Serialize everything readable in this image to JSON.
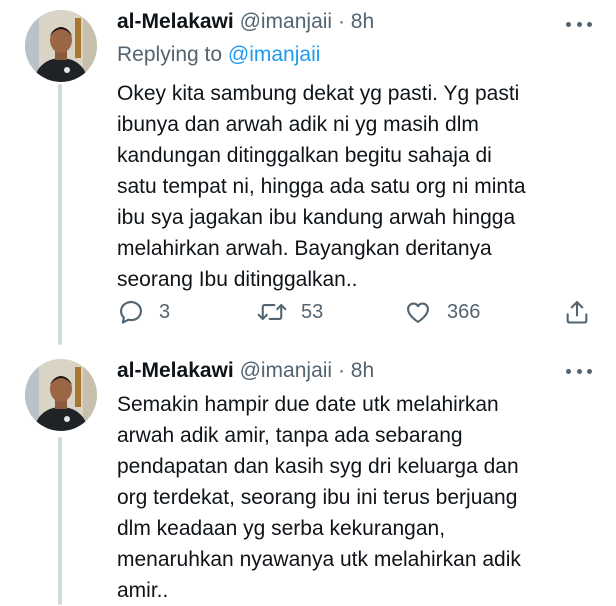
{
  "tweets": [
    {
      "author": {
        "name": "al-Melakawi",
        "handle": "@imanjaii",
        "separator": "·",
        "time": "8h"
      },
      "replying": {
        "prefix": "Replying to",
        "mention": "@imanjaii"
      },
      "text": "Okey kita sambung dekat yg pasti. Yg pasti\nibunya dan arwah adik ni yg masih dlm\nkandungan ditinggalkan begitu sahaja di\nsatu tempat ni, hingga ada satu org ni minta\nibu sya jagakan ibu kandung arwah hingga\nmelahirkan arwah. Bayangkan deritanya\nseorang Ibu ditinggalkan..",
      "stats": {
        "replies": "3",
        "retweets": "53",
        "likes": "366"
      },
      "icons": {
        "more": "more-dots-icon",
        "reply": "reply-icon",
        "retweet": "retweet-icon",
        "like": "heart-icon",
        "share": "share-icon"
      }
    },
    {
      "author": {
        "name": "al-Melakawi",
        "handle": "@imanjaii",
        "separator": "·",
        "time": "8h"
      },
      "text": "Semakin hampir due date utk melahirkan\narwah adik amir, tanpa ada sebarang\npendapatan dan kasih syg dri keluarga dan\norg terdekat, seorang ibu ini terus berjuang\ndlm keadaan yg serba kekurangan,\nmenaruhkan nyawanya utk melahirkan adik\namir..",
      "icons": {
        "more": "more-dots-icon"
      }
    }
  ],
  "colors": {
    "text": "#0f1419",
    "secondary": "#536471",
    "accent": "#1d9bf0",
    "thread_line": "#cfd9de"
  }
}
